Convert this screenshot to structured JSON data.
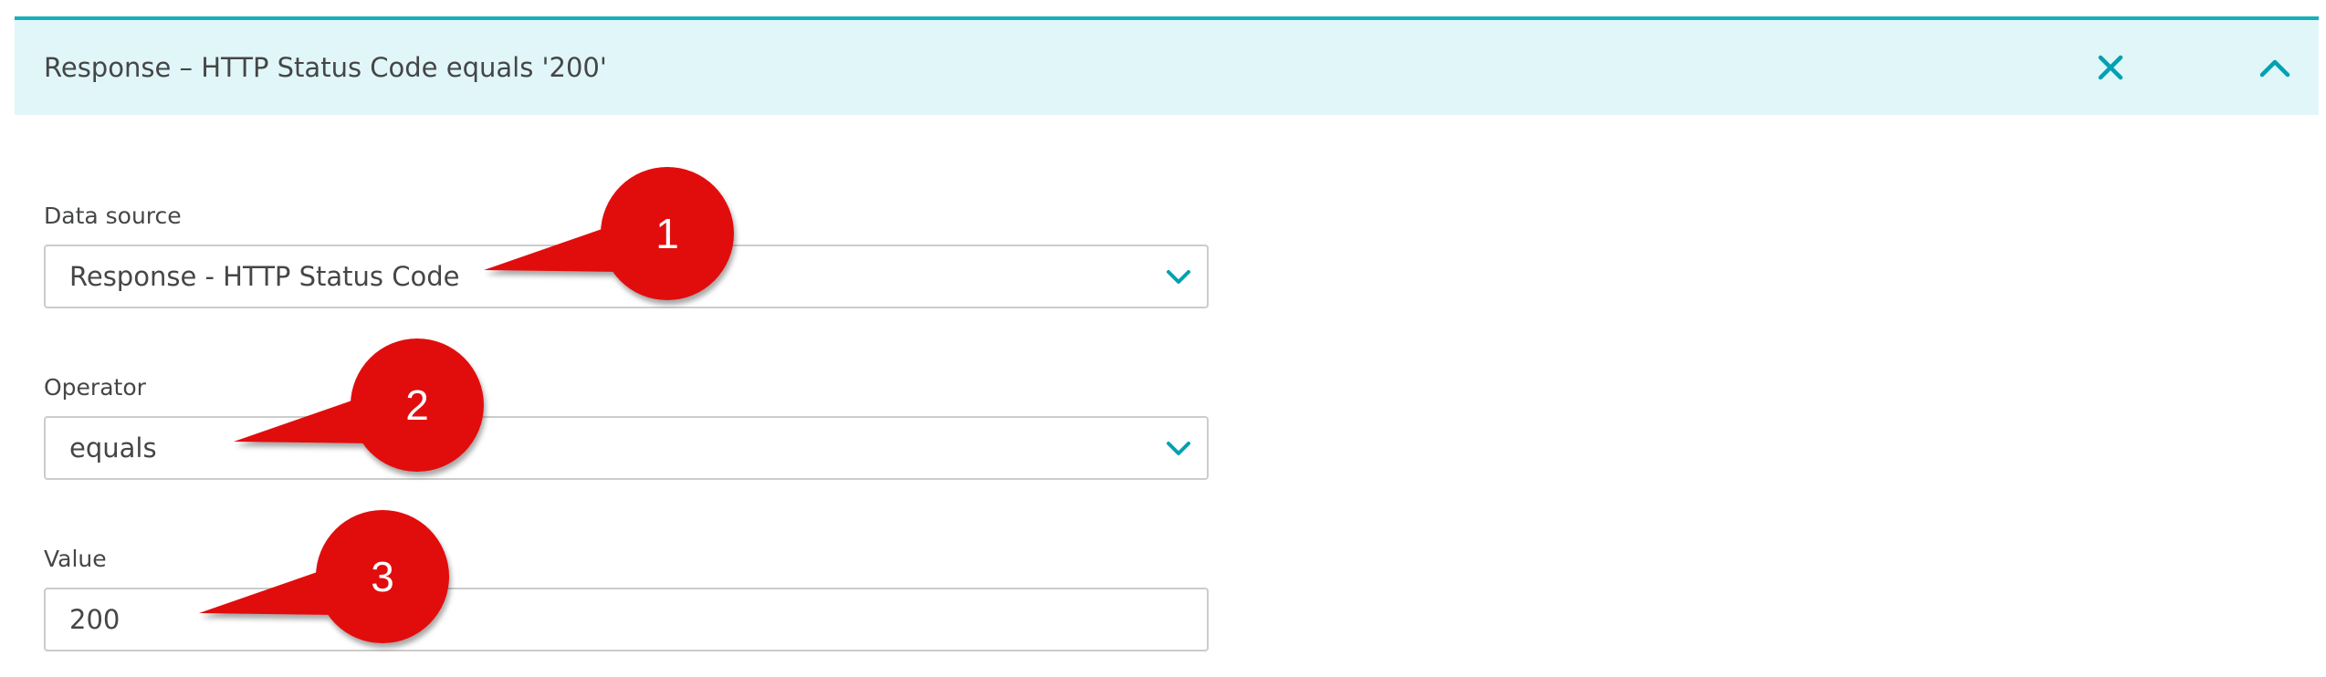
{
  "panel": {
    "title": "Response – HTTP Status Code equals '200'",
    "close_icon": "close-icon",
    "collapse_icon": "chevron-up-icon"
  },
  "fields": {
    "data_source": {
      "label": "Data source",
      "value": "Response - HTTP Status Code",
      "icon": "chevron-down-icon"
    },
    "operator": {
      "label": "Operator",
      "value": "equals",
      "icon": "chevron-down-icon"
    },
    "value": {
      "label": "Value",
      "value": "200"
    }
  },
  "callouts": [
    "1",
    "2",
    "3"
  ],
  "colors": {
    "accent": "#00a1b2",
    "header_bg": "#e1f6f9",
    "header_border": "#17b0bb",
    "callout_red": "#e10f0f",
    "text": "#454646",
    "field_border": "#cccccc"
  }
}
